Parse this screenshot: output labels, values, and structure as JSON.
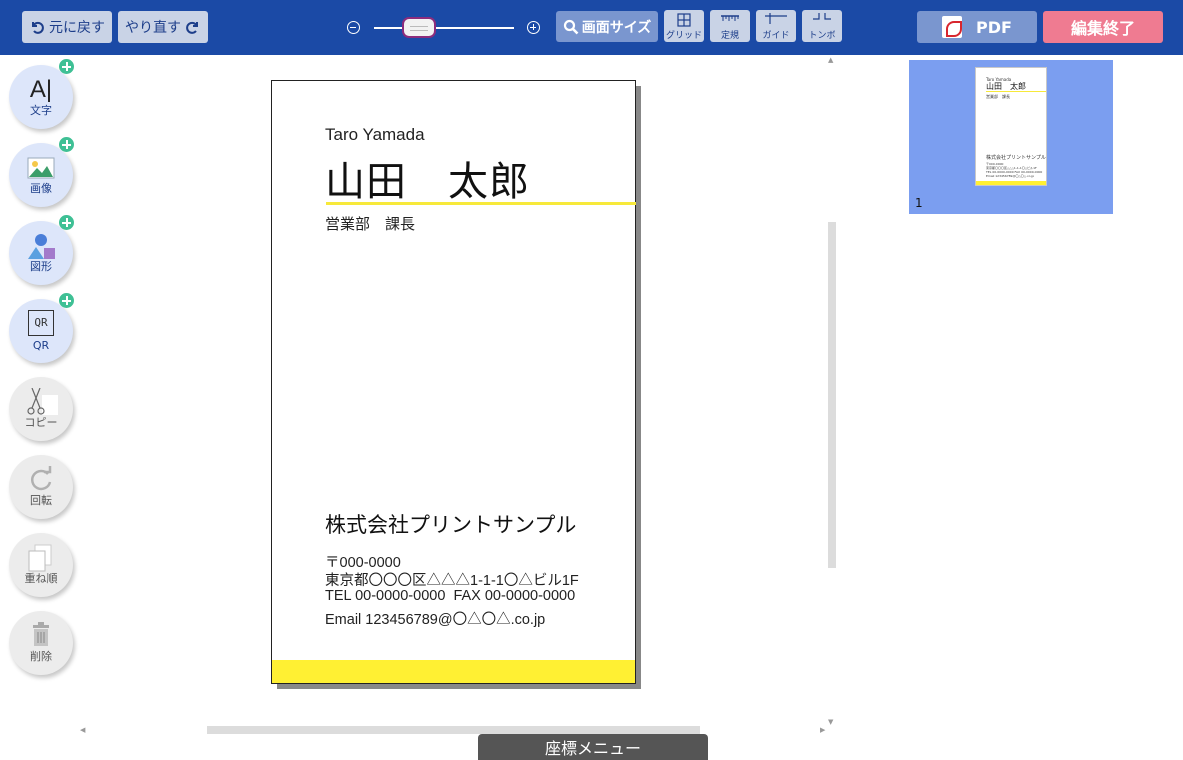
{
  "toolbar": {
    "undo_label": "元に戻す",
    "redo_label": "やり直す",
    "fit_label": "画面サイズ",
    "grid_label": "グリッド",
    "ruler_label": "定規",
    "guide_label": "ガイド",
    "tombo_label": "トンボ",
    "pdf_label": "PDF",
    "finish_label": "編集終了"
  },
  "tools": [
    {
      "label": "文字",
      "icon": "text-icon",
      "state": "active"
    },
    {
      "label": "画像",
      "icon": "image-icon",
      "state": "active"
    },
    {
      "label": "図形",
      "icon": "shape-icon",
      "state": "active"
    },
    {
      "label": "QR",
      "icon": "qr-icon",
      "state": "active"
    },
    {
      "label": "コピー",
      "icon": "scissors-icon",
      "state": "inactive"
    },
    {
      "label": "回転",
      "icon": "rotate-icon",
      "state": "inactive"
    },
    {
      "label": "重ね順",
      "icon": "layer-order-icon",
      "state": "inactive"
    },
    {
      "label": "削除",
      "icon": "trash-icon",
      "state": "inactive"
    }
  ],
  "tool_icon_text": {
    "text": "A|",
    "qr": "QR"
  },
  "card": {
    "name_en": "Taro Yamada",
    "name_ja": "山田　太郎",
    "title": "営業部　課長",
    "company": "株式会社プリントサンプル",
    "postal": "〒000-0000",
    "address": "東京都〇〇〇区△△△1-1-1〇△ビル1F",
    "tel_fax": "TEL 00-0000-0000  FAX 00-0000-0000",
    "email": "Email 123456789@〇△〇△.co.jp",
    "accent_color": "#fff033"
  },
  "pages": {
    "current": "1"
  },
  "coord_menu_label": "座標メニュー",
  "colors": {
    "toolbar_bg": "#1b4aa6",
    "finish_button": "#ef7b91",
    "page_panel": "#7b9ef0",
    "plus_badge": "#3fc095"
  }
}
